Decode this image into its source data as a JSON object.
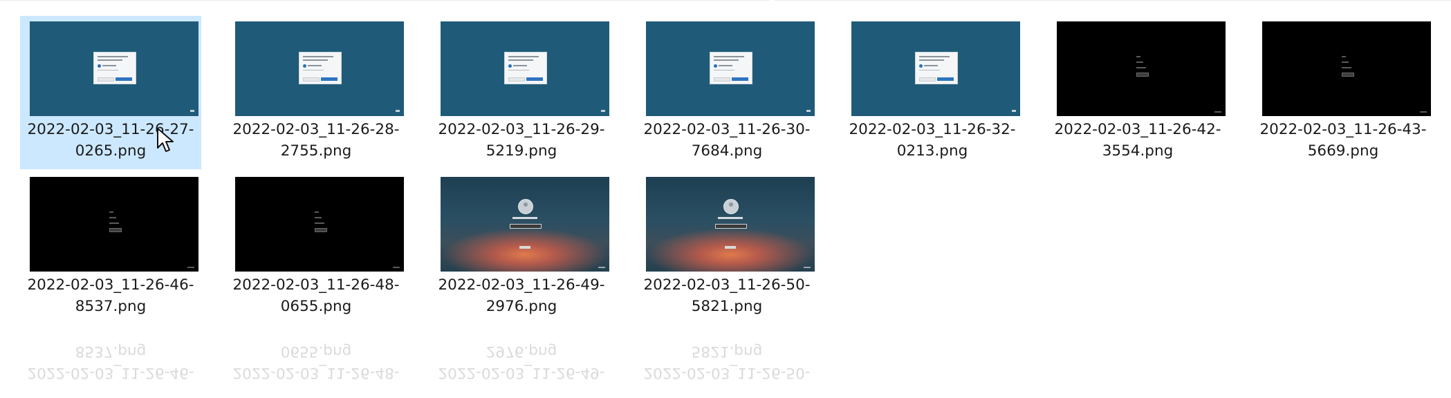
{
  "files": [
    {
      "name": "2022-02-03_11-26-27-0265.png",
      "line1": "2022-02-03_11-26-27-",
      "line2": "0265.png",
      "thumb": "teal-dialog",
      "selected": true
    },
    {
      "name": "2022-02-03_11-26-28-2755.png",
      "line1": "2022-02-03_11-26-28-",
      "line2": "2755.png",
      "thumb": "teal-dialog",
      "selected": false
    },
    {
      "name": "2022-02-03_11-26-29-5219.png",
      "line1": "2022-02-03_11-26-29-",
      "line2": "5219.png",
      "thumb": "teal-dialog",
      "selected": false
    },
    {
      "name": "2022-02-03_11-26-30-7684.png",
      "line1": "2022-02-03_11-26-30-",
      "line2": "7684.png",
      "thumb": "teal-dialog",
      "selected": false
    },
    {
      "name": "2022-02-03_11-26-32-0213.png",
      "line1": "2022-02-03_11-26-32-",
      "line2": "0213.png",
      "thumb": "teal-dialog",
      "selected": false
    },
    {
      "name": "2022-02-03_11-26-42-3554.png",
      "line1": "2022-02-03_11-26-42-",
      "line2": "3554.png",
      "thumb": "black-setup",
      "selected": false
    },
    {
      "name": "2022-02-03_11-26-43-5669.png",
      "line1": "2022-02-03_11-26-43-",
      "line2": "5669.png",
      "thumb": "black-setup",
      "selected": false
    },
    {
      "name": "2022-02-03_11-26-46-8537.png",
      "line1": "2022-02-03_11-26-46-",
      "line2": "8537.png",
      "thumb": "black-setup",
      "selected": false
    },
    {
      "name": "2022-02-03_11-26-48-0655.png",
      "line1": "2022-02-03_11-26-48-",
      "line2": "0655.png",
      "thumb": "black-setup",
      "selected": false
    },
    {
      "name": "2022-02-03_11-26-49-2976.png",
      "line1": "2022-02-03_11-26-49-",
      "line2": "2976.png",
      "thumb": "lock-screen",
      "selected": false
    },
    {
      "name": "2022-02-03_11-26-50-5821.png",
      "line1": "2022-02-03_11-26-50-",
      "line2": "5821.png",
      "thumb": "lock-screen",
      "selected": false
    }
  ],
  "colors": {
    "selection": "#cce8ff",
    "teal": "#1f5b78",
    "black": "#000000"
  },
  "icons": {
    "cursor": "mouse-pointer-icon"
  }
}
